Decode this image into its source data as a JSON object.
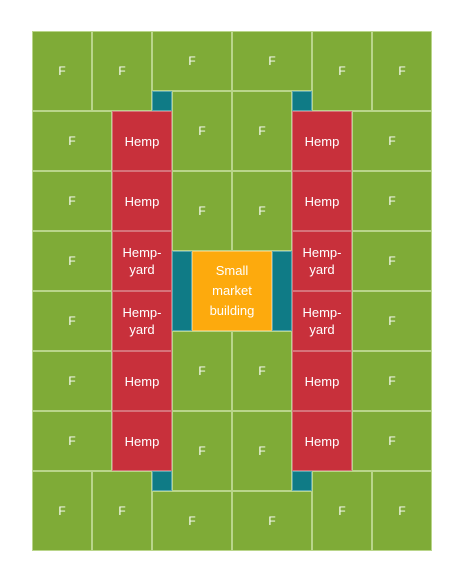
{
  "legend_colors": {
    "field": "#7fab37",
    "hemp": "#c8303b",
    "market": "#fdaa0d",
    "marker": "#0f7b86"
  },
  "labels": {
    "field": "F",
    "hemp": "Hemp",
    "hempyard_line1": "Hemp-",
    "hempyard_line2": "yard",
    "market_line1": "Small",
    "market_line2": "market",
    "market_line3": "building"
  }
}
